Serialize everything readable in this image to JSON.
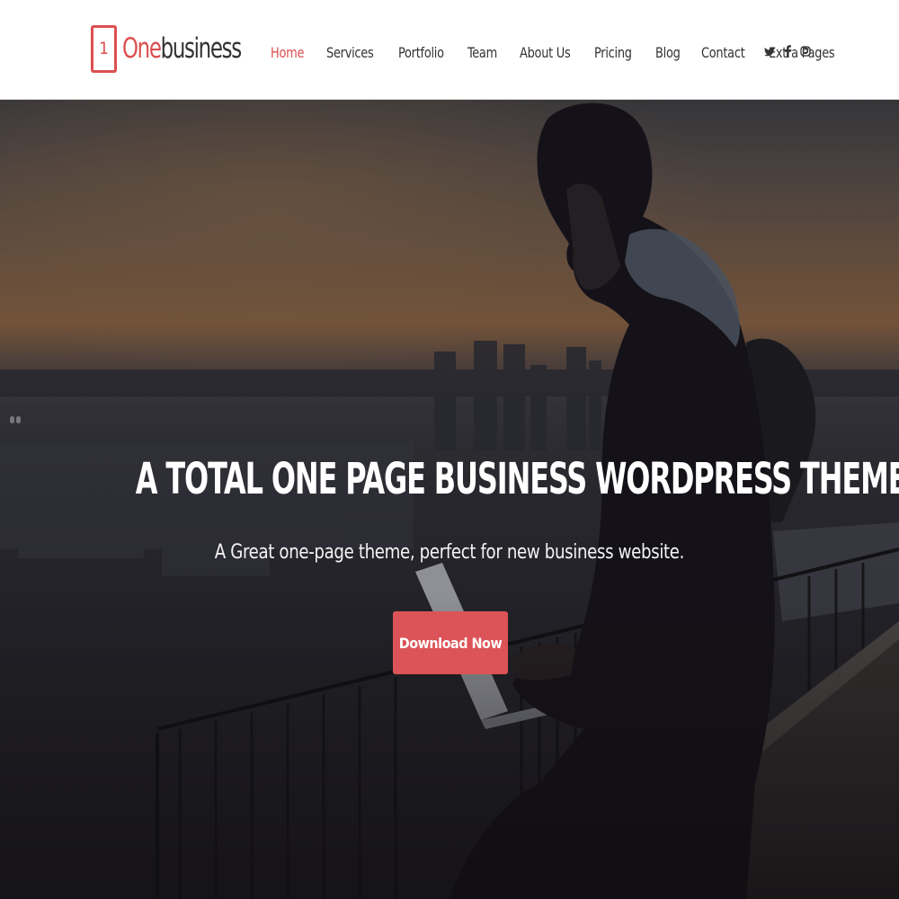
{
  "header": {
    "logo": {
      "mark": "1",
      "accent": "One",
      "rest": "business"
    },
    "nav": [
      {
        "label": "Home",
        "active": true
      },
      {
        "label": "Services",
        "active": false
      },
      {
        "label": "Portfolio",
        "active": false
      },
      {
        "label": "Team",
        "active": false
      },
      {
        "label": "About Us",
        "active": false
      },
      {
        "label": "Pricing",
        "active": false
      },
      {
        "label": "Blog",
        "active": false
      },
      {
        "label": "Contact",
        "active": false
      },
      {
        "label": "Extra Pages",
        "active": false
      }
    ],
    "social": [
      "twitter-icon",
      "facebook-icon",
      "instagram-icon"
    ]
  },
  "hero": {
    "title": "A TOTAL ONE PAGE BUSINESS WORDPRESS THEME",
    "subtitle": "A Great one-page theme, perfect for new business website.",
    "cta_label": "Download Now"
  },
  "colors": {
    "accent": "#dc4f50",
    "button": "#dc5457",
    "nav_text": "#333333",
    "header_bg": "#ffffff"
  }
}
